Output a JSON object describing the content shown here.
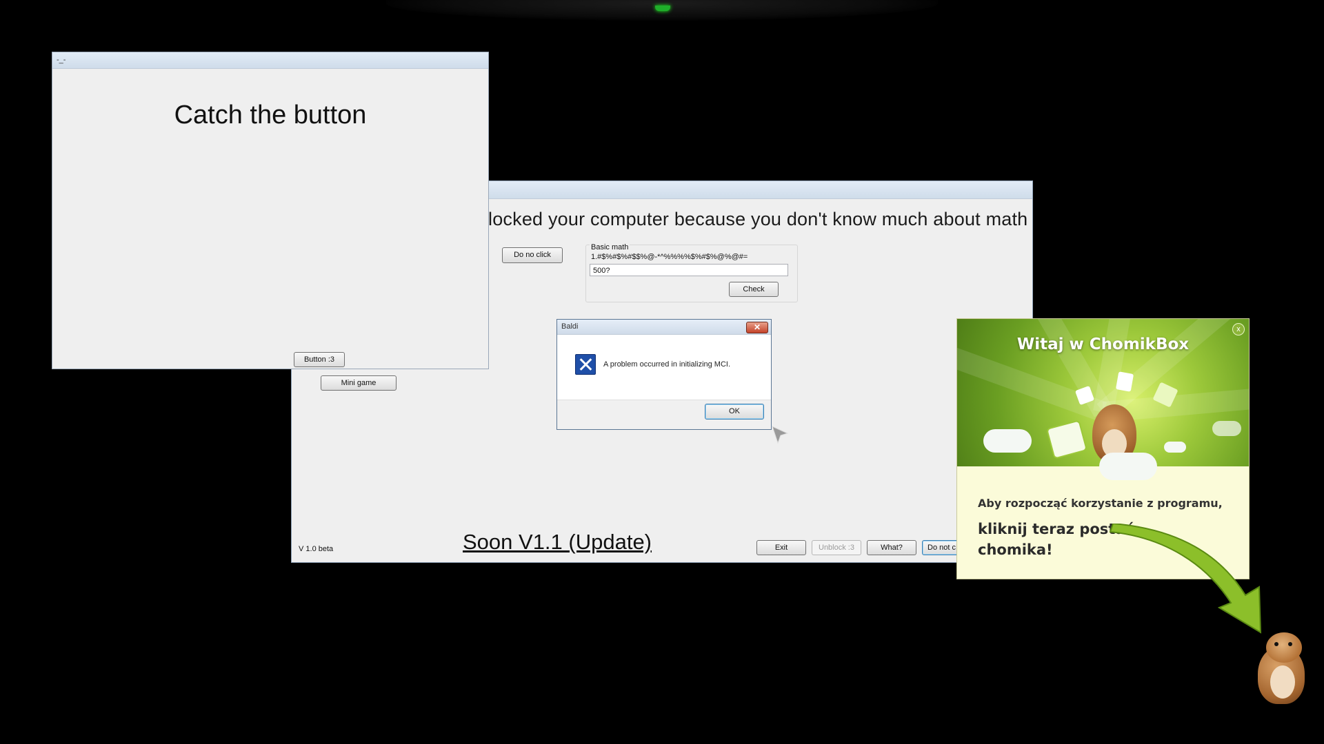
{
  "desktop": {
    "background": "#000000"
  },
  "catch_window": {
    "title": "-_-",
    "heading": "Catch the button",
    "button_label": "Button :3"
  },
  "main_window": {
    "headline": "locked your computer because you don't know much about math",
    "do_no_click_label": "Do no click",
    "math_group": {
      "label": "Basic math",
      "question": "1.#$%#$%#$$%@-*^%%%%$%#$%@%@#=",
      "input_value": "500?",
      "check_label": "Check"
    },
    "mini_game_label": "Mini game",
    "version": "V 1.0 beta",
    "soon_link": "Soon V1.1 (Update)",
    "buttons": {
      "exit": "Exit",
      "unblock": "Unblock :3",
      "what": "What?",
      "do_not": "Do not c"
    }
  },
  "error_dialog": {
    "title": "Baldi",
    "message": "A problem occurred in initializing MCI.",
    "ok_label": "OK",
    "icon": "error-x-icon"
  },
  "chomik_popup": {
    "title": "Witaj w ChomikBox",
    "line1": "Aby rozpocząć korzystanie z programu,",
    "line2": "kliknij teraz postać chomika!",
    "close_symbol": "x",
    "accent": "#8db53a"
  }
}
